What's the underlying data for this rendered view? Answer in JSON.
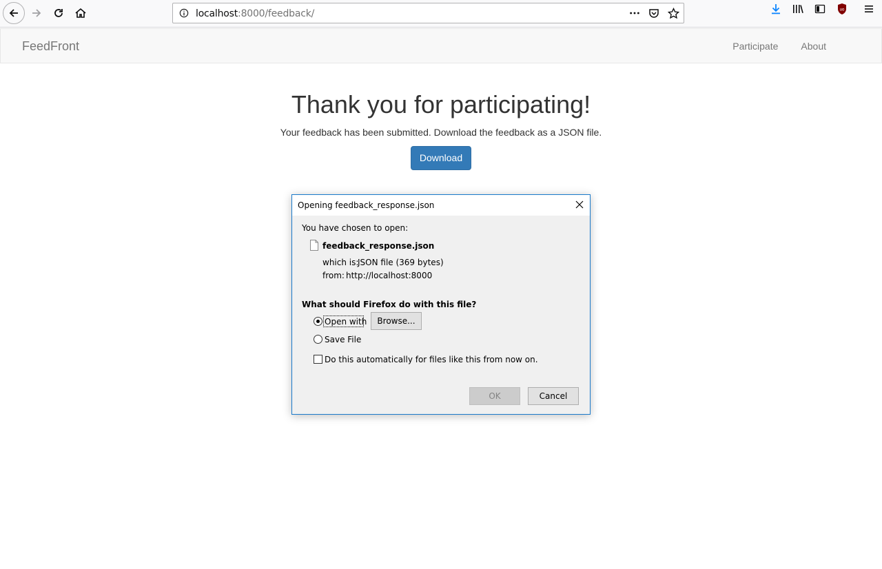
{
  "browser": {
    "url_host": "localhost",
    "url_rest": ":8000/feedback/"
  },
  "navbar": {
    "brand": "FeedFront",
    "links": [
      {
        "label": "Participate"
      },
      {
        "label": "About"
      }
    ]
  },
  "main": {
    "heading": "Thank you for participating!",
    "subtext": "Your feedback has been submitted. Download the feedback as a JSON file.",
    "download_label": "Download"
  },
  "dialog": {
    "title": "Opening feedback_response.json",
    "chosen_label": "You have chosen to open:",
    "file_name": "feedback_response.json",
    "which_is_label": "which is:",
    "which_is_value": "JSON file (369 bytes)",
    "from_label": "from:",
    "from_value": "http://localhost:8000",
    "question": "What should Firefox do with this file?",
    "open_with_label": "Open with",
    "open_with_selected": true,
    "browse_label": "Browse...",
    "save_file_label": "Save File",
    "auto_label": "Do this automatically for files like this from now on.",
    "auto_checked": false,
    "ok_label": "OK",
    "cancel_label": "Cancel"
  },
  "colors": {
    "primary_button": "#337ab7",
    "dialog_border": "#1979ca",
    "download_icon": "#0a84ff",
    "ublock_icon": "#800000"
  }
}
